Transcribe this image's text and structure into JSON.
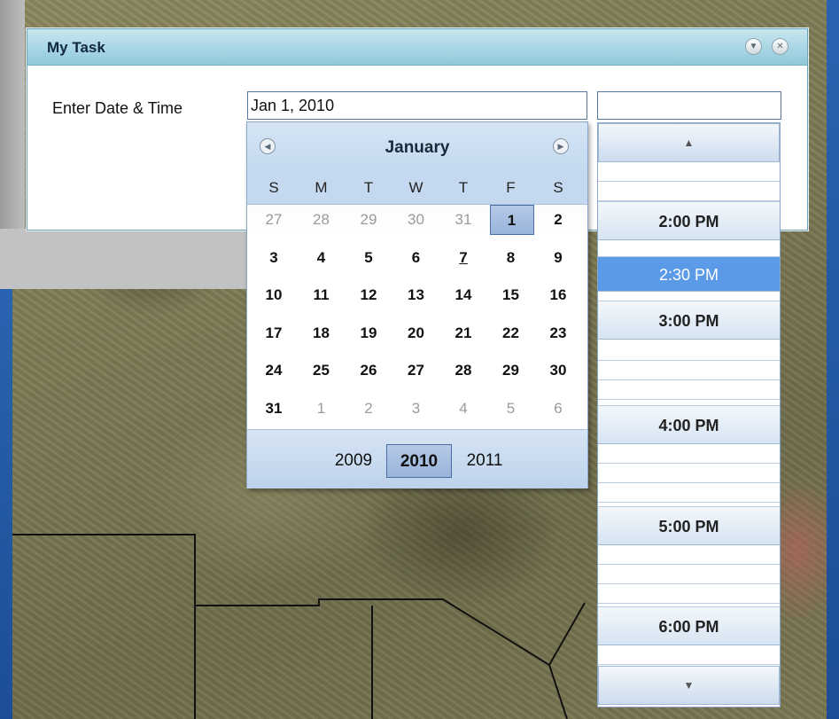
{
  "window": {
    "title": "My Task",
    "collapse_icon": "chevron-down-icon",
    "close_icon": "close-icon"
  },
  "form": {
    "date_label": "Enter Date & Time",
    "date_value": "Jan 1, 2010",
    "time_value": ""
  },
  "calendar": {
    "month": "January",
    "prev_icon": "chevron-left-circle-icon",
    "next_icon": "chevron-right-circle-icon",
    "weekdays": [
      "S",
      "M",
      "T",
      "W",
      "T",
      "F",
      "S"
    ],
    "weeks": [
      [
        "27",
        "28",
        "29",
        "30",
        "31",
        "1",
        "2"
      ],
      [
        "3",
        "4",
        "5",
        "6",
        "7",
        "8",
        "9"
      ],
      [
        "10",
        "11",
        "12",
        "13",
        "14",
        "15",
        "16"
      ],
      [
        "17",
        "18",
        "19",
        "20",
        "21",
        "22",
        "23"
      ],
      [
        "24",
        "25",
        "26",
        "27",
        "28",
        "29",
        "30"
      ],
      [
        "31",
        "1",
        "2",
        "3",
        "4",
        "5",
        "6"
      ]
    ],
    "selected_day": "1",
    "underlined_day": "7",
    "years": [
      "2009",
      "2010",
      "2011"
    ],
    "selected_year": "2010"
  },
  "time_list": {
    "scroll_up_icon": "triangle-up-icon",
    "scroll_down_icon": "triangle-down-icon",
    "slots": [
      "2:00 PM",
      "2:30 PM",
      "3:00 PM",
      "4:00 PM",
      "5:00 PM",
      "6:00 PM"
    ],
    "selected": "2:30 PM"
  },
  "colors": {
    "title_bar": "#a8d6e4",
    "selection": "#5b9ae6",
    "calendar_header": "#c4d9ef"
  }
}
